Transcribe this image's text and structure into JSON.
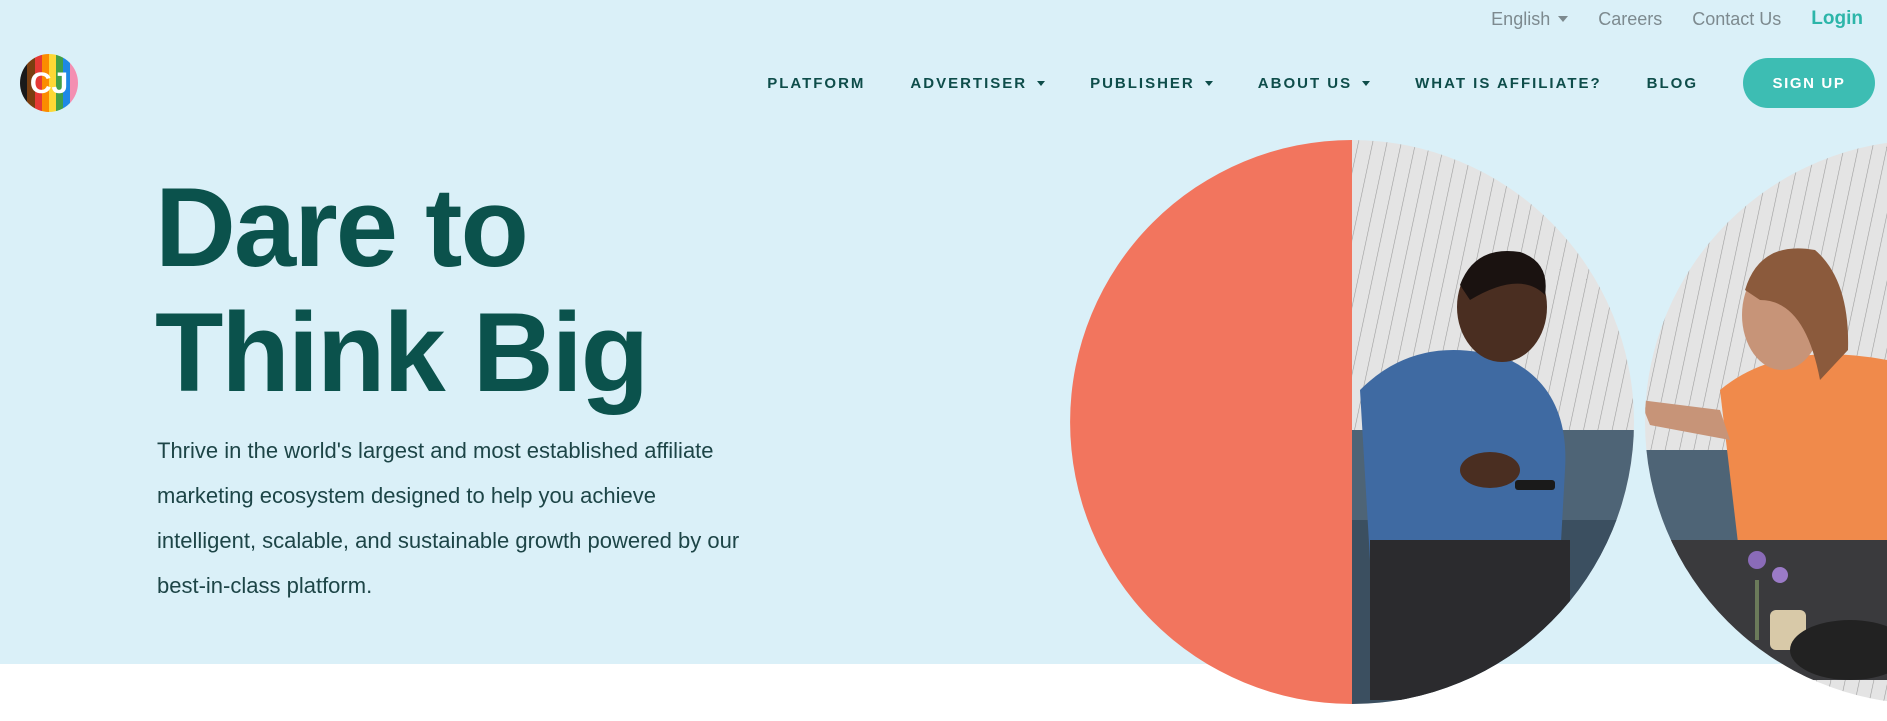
{
  "utility": {
    "language": "English",
    "careers": "Careers",
    "contact": "Contact Us",
    "login": "Login"
  },
  "nav": {
    "items": [
      {
        "label": "PLATFORM",
        "dropdown": false
      },
      {
        "label": "ADVERTISER",
        "dropdown": true
      },
      {
        "label": "PUBLISHER",
        "dropdown": true
      },
      {
        "label": "ABOUT US",
        "dropdown": true
      },
      {
        "label": "WHAT IS AFFILIATE?",
        "dropdown": false
      },
      {
        "label": "BLOG",
        "dropdown": false
      }
    ],
    "signup": "SIGN UP"
  },
  "logo": {
    "letters": "CJ"
  },
  "hero": {
    "headline_line1": "Dare to",
    "headline_line2": "Think Big",
    "subtext": "Thrive in the world's largest and most established affiliate marketing ecosystem designed to help you achieve intelligent, scalable, and sustainable growth powered by our best-in-class platform."
  },
  "colors": {
    "hero_bg": "#daf0f8",
    "headline": "#0b524c",
    "accent": "#3dbdb3",
    "coral": "#f2755e"
  }
}
